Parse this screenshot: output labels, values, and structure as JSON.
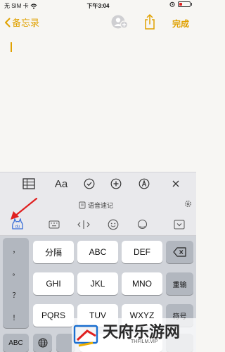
{
  "status_bar": {
    "carrier": "无 SIM 卡",
    "time": "下午3:04"
  },
  "nav": {
    "back_label": "备忘录",
    "done_label": "完成"
  },
  "format_toolbar": {
    "icons": [
      "table-icon",
      "text-format-icon",
      "checklist-icon",
      "add-icon",
      "markup-icon",
      "close-icon"
    ],
    "text_format_label": "Aa"
  },
  "voice": {
    "label": "语音速记"
  },
  "ime_toolbar": {
    "icons": [
      "ime-logo-icon",
      "keyboard-icon",
      "cursor-move-icon",
      "emoji-icon",
      "search-icon",
      "collapse-keyboard-icon"
    ]
  },
  "keyboard": {
    "punctuation": [
      "，",
      "。",
      "？",
      "！"
    ],
    "rows": [
      [
        "分隔",
        "ABC",
        "DEF"
      ],
      [
        "GHI",
        "JKL",
        "MNO"
      ],
      [
        "PQRS",
        "TUV",
        "WXYZ"
      ]
    ],
    "right_keys": [
      "⌫",
      "重输",
      "符号"
    ],
    "bottom": {
      "abc_label": "ABC"
    }
  },
  "watermark": {
    "title": "天府乐游网",
    "url": "THFILM.VIP"
  },
  "colors": {
    "accent": "#e0a100",
    "background": "#f7f6f3",
    "toolbar": "#e9e9ec",
    "keyboard_bg": "#d0d3d9",
    "annotation_arrow": "#e02020"
  }
}
